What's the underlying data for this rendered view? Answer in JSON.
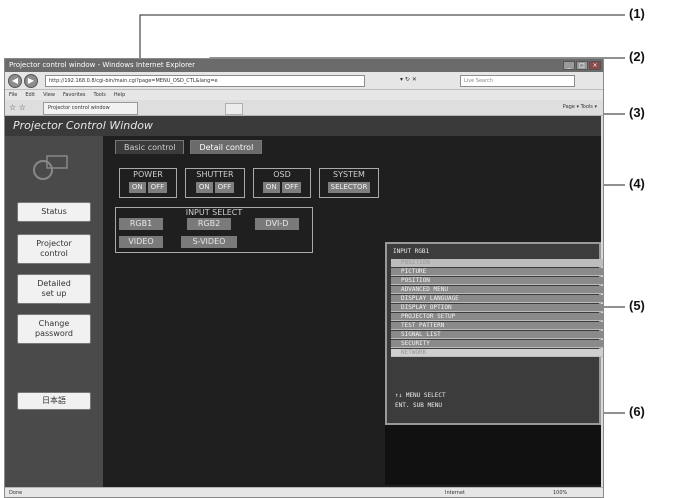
{
  "window": {
    "title": "Projector control window - Windows Internet Explorer",
    "url": "http://192.168.0.8/cgi-bin/main.cgi?page=MENU_OSD_CTL&lang=e",
    "search_placeholder": "Live Search",
    "menu": [
      "File",
      "Edit",
      "View",
      "Favorites",
      "Tools",
      "Help"
    ],
    "tab_label": "Projector control window",
    "tab_tools": "Page ▾  Tools ▾",
    "status_left": "Done",
    "status_mid": "Internet",
    "status_zoom": "100%"
  },
  "page": {
    "header_title": "Projector Control Window",
    "sidebar": {
      "status": "Status",
      "projector_control": "Projector control",
      "detailed_setup": "Detailed set up",
      "change_password": "Change password",
      "language": "日本語"
    },
    "tabs": {
      "basic": "Basic control",
      "detail": "Detail control"
    },
    "power": {
      "title": "POWER",
      "on": "ON",
      "off": "OFF"
    },
    "shutter": {
      "title": "SHUTTER",
      "on": "ON",
      "off": "OFF"
    },
    "osd": {
      "title": "OSD",
      "on": "ON",
      "off": "OFF"
    },
    "system": {
      "title": "SYSTEM",
      "selector": "SELECTOR"
    },
    "input_select": {
      "title": "INPUT SELECT",
      "rgb1": "RGB1",
      "rgb2": "RGB2",
      "dvid": "DVI-D",
      "video": "VIDEO",
      "svideo": "S-VIDEO"
    },
    "osd_screen": {
      "title": "INPUT RGB1",
      "items": [
        "POSITION",
        "PICTURE",
        "POSITION",
        "ADVANCED MENU",
        "DISPLAY LANGUAGE",
        "DISPLAY OPTION",
        "PROJECTOR SETUP",
        "TEST PATTERN",
        "SIGNAL LIST",
        "SECURITY",
        "NETWORK"
      ],
      "hint1": "↑↓   MENU SELECT",
      "hint2": "ENT.  SUB MENU"
    }
  },
  "callouts": [
    "(1)",
    "(2)",
    "(3)",
    "(4)",
    "(5)",
    "(6)"
  ]
}
